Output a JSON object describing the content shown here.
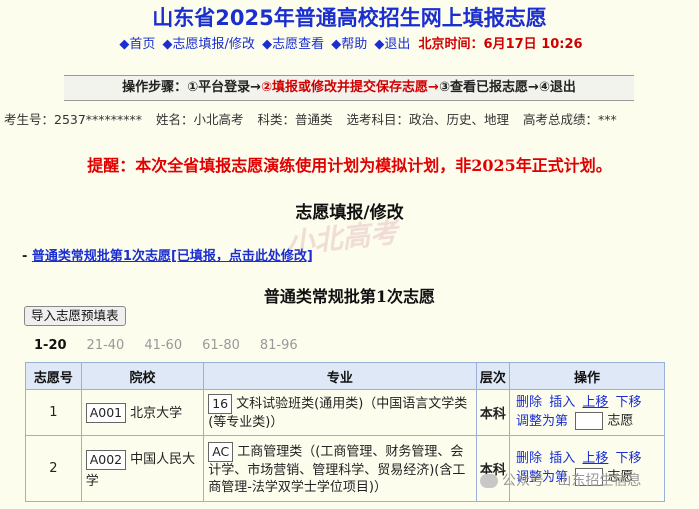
{
  "header": {
    "title": "山东省2025年普通高校招生网上填报志愿",
    "nav": [
      "首页",
      "志愿填报/修改",
      "志愿查看",
      "帮助",
      "退出"
    ],
    "time_label": "北京时间：6月17日 10:26"
  },
  "steps": {
    "label": "操作步骤：",
    "items": [
      "①平台登录→",
      "②填报或修改并提交保存志愿→",
      "③查看已报志愿→",
      "④退出"
    ]
  },
  "student": {
    "exam_no": "考生号：2537*********",
    "name": "姓名：小北高考",
    "category": "科类：普通类",
    "subjects": "选考科目：政治、历史、地理",
    "score": "高考总成绩：***"
  },
  "warning": "提醒：本次全省填报志愿演练使用计划为模拟计划，非2025年正式计划。",
  "section_title": "志愿填报/修改",
  "batch_link": "普通类常规批第1次志愿[已填报，点击此处修改]",
  "batch_title": "普通类常规批第1次志愿",
  "import_button": "导入志愿预填表",
  "pager": [
    "1-20",
    "21-40",
    "41-60",
    "61-80",
    "81-96"
  ],
  "table": {
    "headers": [
      "志愿号",
      "院校",
      "专业",
      "层次",
      "操作"
    ],
    "rows": [
      {
        "no": "1",
        "school_code": "A001",
        "school": "北京大学",
        "major_code": "16",
        "major": "文科试验班类(通用类)（中国语言文学类(等专业类)）",
        "level": "本科"
      },
      {
        "no": "2",
        "school_code": "A002",
        "school": "中国人民大学",
        "major_code": "AC",
        "major": "工商管理类（(工商管理、财务管理、会计学、市场营销、管理科学、贸易经济)(含工商管理-法学双学士学位项目)）",
        "level": "本科"
      }
    ],
    "ops": {
      "delete": "删除",
      "insert": "插入",
      "up": "上移",
      "down": "下移",
      "adjust_prefix": "调整为第",
      "adjust_suffix": "志愿"
    }
  },
  "watermark": "小北高考",
  "wechat_text": "公众号 · 山东招生信息"
}
